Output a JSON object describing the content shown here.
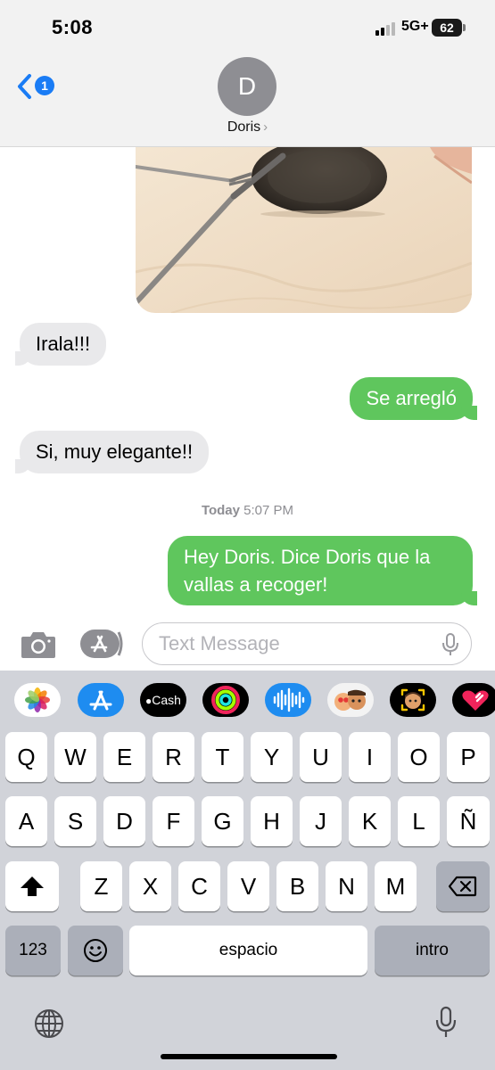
{
  "status_bar": {
    "time": "5:08",
    "network": "5G+",
    "battery": "62"
  },
  "header": {
    "back_badge": "1",
    "avatar_initial": "D",
    "contact_name": "Doris",
    "contact_chevron": "›"
  },
  "colors": {
    "accent": "#1a7cf5",
    "sent_bubble": "#5fc65d",
    "received_bubble": "#e9e9eb",
    "keyboard_bg": "#d1d3d9"
  },
  "messages": [
    {
      "direction": "received",
      "text": "Irala!!!"
    },
    {
      "direction": "sent",
      "text": "Se arregló"
    },
    {
      "direction": "received",
      "text": "Si, muy elegante!!"
    },
    {
      "direction": "sent",
      "text": "Hey Doris. Dice Doris que la vallas a recoger!"
    }
  ],
  "timestamp": {
    "day": "Today",
    "time": "5:07 PM"
  },
  "input": {
    "placeholder": "Text Message"
  },
  "app_strip": [
    {
      "icon": "photos-icon"
    },
    {
      "icon": "app-store-icon"
    },
    {
      "icon": "apple-cash-icon",
      "label": "Cash"
    },
    {
      "icon": "activity-icon"
    },
    {
      "icon": "audio-message-icon"
    },
    {
      "icon": "memoji-stickers-icon"
    },
    {
      "icon": "memoji-icon"
    },
    {
      "icon": "digital-touch-icon"
    }
  ],
  "keyboard": {
    "row1": [
      "Q",
      "W",
      "E",
      "R",
      "T",
      "Y",
      "U",
      "I",
      "O",
      "P"
    ],
    "row2": [
      "A",
      "S",
      "D",
      "F",
      "G",
      "H",
      "J",
      "K",
      "L",
      "Ñ"
    ],
    "row3": [
      "Z",
      "X",
      "C",
      "V",
      "B",
      "N",
      "M"
    ],
    "numbers_label": "123",
    "space_label": "espacio",
    "return_label": "intro"
  }
}
